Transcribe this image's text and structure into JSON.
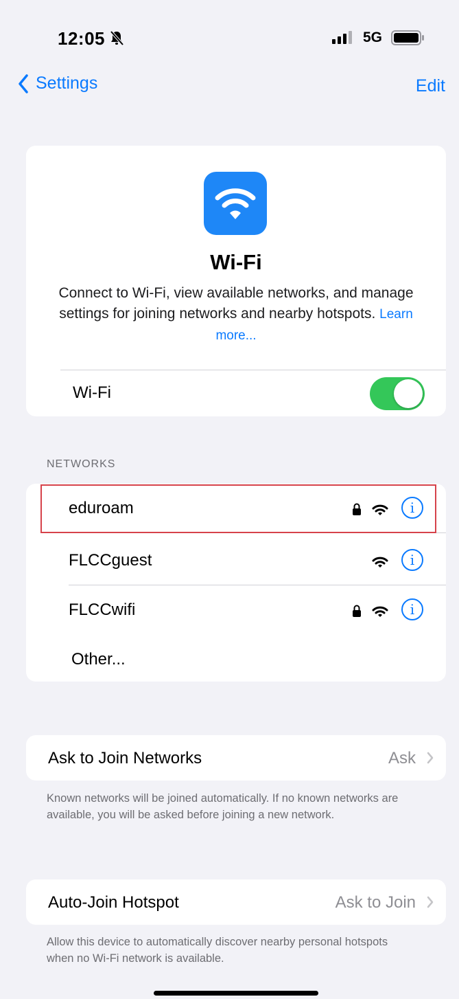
{
  "status_bar": {
    "time": "12:05",
    "network_type": "5G",
    "icons": [
      "bell-slash-icon",
      "signal-bars-icon",
      "battery-icon"
    ]
  },
  "nav": {
    "back_label": "Settings",
    "edit_label": "Edit"
  },
  "hero": {
    "icon": "wifi-icon",
    "title": "Wi-Fi",
    "description": "Connect to Wi-Fi, view available networks, and manage settings for joining networks and nearby hotspots.",
    "learn_more": "Learn more...",
    "toggle_label": "Wi-Fi",
    "toggle_on": true
  },
  "networks": {
    "header": "NETWORKS",
    "items": [
      {
        "name": "eduroam",
        "secured": true,
        "highlighted": true
      },
      {
        "name": "FLCCguest",
        "secured": false
      },
      {
        "name": "FLCCwifi",
        "secured": true
      },
      {
        "name": "Other..."
      }
    ]
  },
  "ask_to_join": {
    "label": "Ask to Join Networks",
    "value": "Ask",
    "footnote": "Known networks will be joined automatically. If no known networks are available, you will be asked before joining a new network."
  },
  "auto_join": {
    "label": "Auto-Join Hotspot",
    "value": "Ask to Join",
    "footnote": "Allow this device to automatically discover nearby personal hotspots when no Wi-Fi network is available."
  },
  "colors": {
    "accent": "#0a7aff",
    "toggle_on": "#34c759",
    "highlight_border": "#d6424a",
    "background": "#f2f2f7"
  }
}
